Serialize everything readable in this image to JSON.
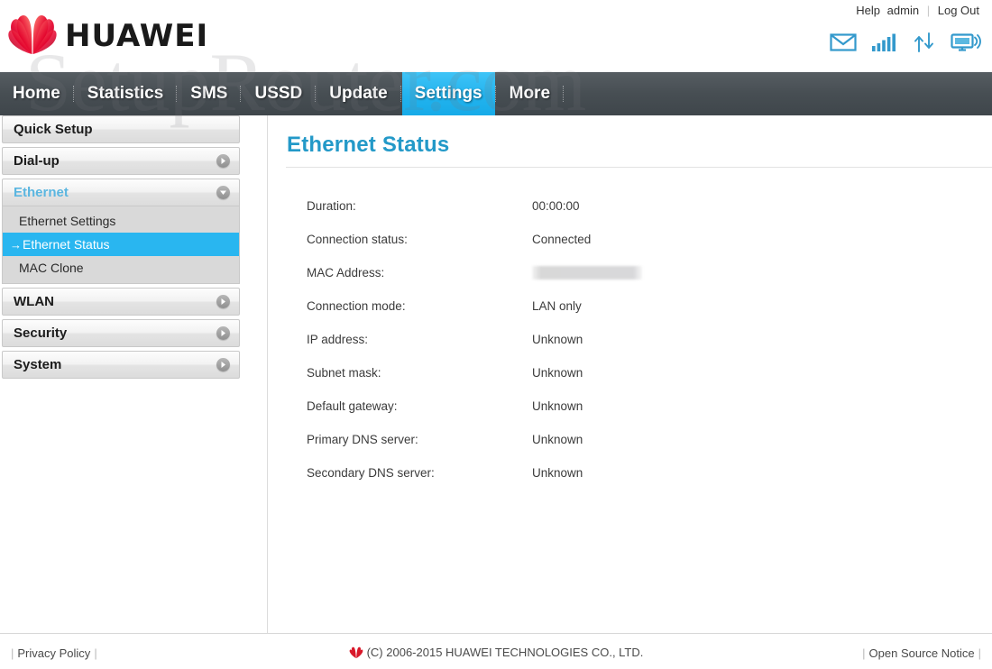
{
  "brand": {
    "name": "HUAWEI",
    "logo_color": "#e4002b"
  },
  "watermark": {
    "text": "SetupRouter.com"
  },
  "top_links": {
    "help": "Help",
    "user": "admin",
    "logout": "Log Out"
  },
  "status_icons": [
    {
      "name": "message-icon",
      "title": "Messages"
    },
    {
      "name": "signal-bars-icon",
      "title": "Signal"
    },
    {
      "name": "data-transfer-icon",
      "title": "Data transfer"
    },
    {
      "name": "device-monitor-icon",
      "title": "Device"
    }
  ],
  "nav": {
    "items": [
      {
        "label": "Home",
        "active": false
      },
      {
        "label": "Statistics",
        "active": false
      },
      {
        "label": "SMS",
        "active": false
      },
      {
        "label": "USSD",
        "active": false
      },
      {
        "label": "Update",
        "active": false
      },
      {
        "label": "Settings",
        "active": true
      },
      {
        "label": "More",
        "active": false
      }
    ],
    "active_color": "#29b6f0",
    "bar_color": "#474e53"
  },
  "sidebar": {
    "groups": [
      {
        "label": "Quick Setup",
        "expandable": false,
        "expanded": false,
        "items": []
      },
      {
        "label": "Dial-up",
        "expandable": true,
        "expanded": false,
        "items": []
      },
      {
        "label": "Ethernet",
        "expandable": true,
        "expanded": true,
        "items": [
          {
            "label": "Ethernet Settings",
            "active": false
          },
          {
            "label": "Ethernet Status",
            "active": true
          },
          {
            "label": "MAC Clone",
            "active": false
          }
        ]
      },
      {
        "label": "WLAN",
        "expandable": true,
        "expanded": false,
        "items": []
      },
      {
        "label": "Security",
        "expandable": true,
        "expanded": false,
        "items": []
      },
      {
        "label": "System",
        "expandable": true,
        "expanded": false,
        "items": []
      }
    ],
    "active_item_color": "#29b6f0",
    "open_group_color": "#5bb6e0"
  },
  "content": {
    "title": "Ethernet Status",
    "title_color": "#2399c8",
    "rows": [
      {
        "label": "Duration:",
        "value": "00:00:00",
        "redacted": false
      },
      {
        "label": "Connection status:",
        "value": "Connected",
        "redacted": false
      },
      {
        "label": "MAC Address:",
        "value": "",
        "redacted": true
      },
      {
        "label": "Connection mode:",
        "value": "LAN only",
        "redacted": false
      },
      {
        "label": "IP address:",
        "value": "Unknown",
        "redacted": false
      },
      {
        "label": "Subnet mask:",
        "value": "Unknown",
        "redacted": false
      },
      {
        "label": "Default gateway:",
        "value": "Unknown",
        "redacted": false
      },
      {
        "label": "Primary DNS server:",
        "value": "Unknown",
        "redacted": false
      },
      {
        "label": "Secondary DNS server:",
        "value": "Unknown",
        "redacted": false
      }
    ]
  },
  "footer": {
    "privacy_policy": "Privacy Policy",
    "copyright": "(C) 2006-2015 HUAWEI TECHNOLOGIES CO., LTD.",
    "open_source_notice": "Open Source Notice"
  }
}
